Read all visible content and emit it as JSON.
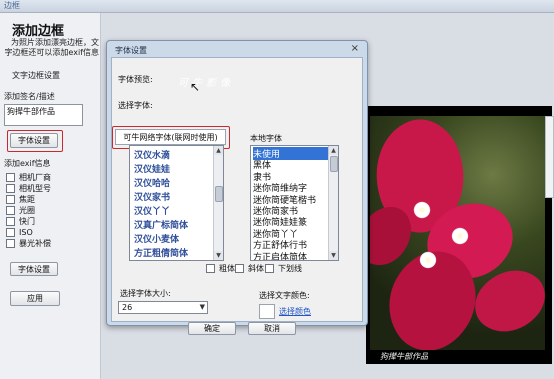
{
  "window": {
    "title": "边框"
  },
  "left_panel": {
    "heading": "添加边框",
    "description": "为照片添加漂亮边框，文字边框还可以添加exif信息",
    "text_border_settings": "文字边框设置",
    "add_signature_label": "添加签名/描述",
    "signature_value": "狗撵牛部作品",
    "font_settings_button": "字体设置",
    "exif_label": "添加exif信息",
    "exif_options": [
      "相机厂商",
      "相机型号",
      "焦距",
      "光圈",
      "快门",
      "ISO",
      "暴光补偿"
    ],
    "font_settings_button_2": "字体设置",
    "apply_button": "应用"
  },
  "dialog": {
    "title": "字体设置",
    "close": "×",
    "preview_label": "字体预览:",
    "preview_text": "可牛影像",
    "select_font_label": "选择字体:",
    "online_tab": "可牛网络字体(联网时使用)",
    "online_fonts": [
      "汉仪水滴",
      "汉仪娃娃",
      "汉仪哈哈",
      "汉仪家书",
      "汉仪丫丫",
      "汉真广标简体",
      "汉仪小麦体",
      "方正粗倩简体"
    ],
    "local_label": "本地字体",
    "local_fonts": [
      "未使用",
      "黑体",
      "隶书",
      "迷你简维纳字",
      "迷你简硬笔楷书",
      "迷你简家书",
      "迷你简娃娃篆",
      "迷你简丫丫",
      "方正舒体行书",
      "方正启体简体"
    ],
    "local_selected_index": 0,
    "bold_label": "粗体",
    "italic_label": "斜体",
    "underline_label": "下划线",
    "size_label": "选择字体大小:",
    "size_value": "26",
    "color_label": "选择文字颜色:",
    "choose_color_link": "选择颜色",
    "ok_button": "确定",
    "cancel_button": "取消"
  },
  "photo": {
    "caption": "狗撵牛部作品"
  },
  "colors": {
    "accent_red": "#c8282e",
    "selection_blue": "#3273d5",
    "link_blue": "#1f56c4"
  }
}
